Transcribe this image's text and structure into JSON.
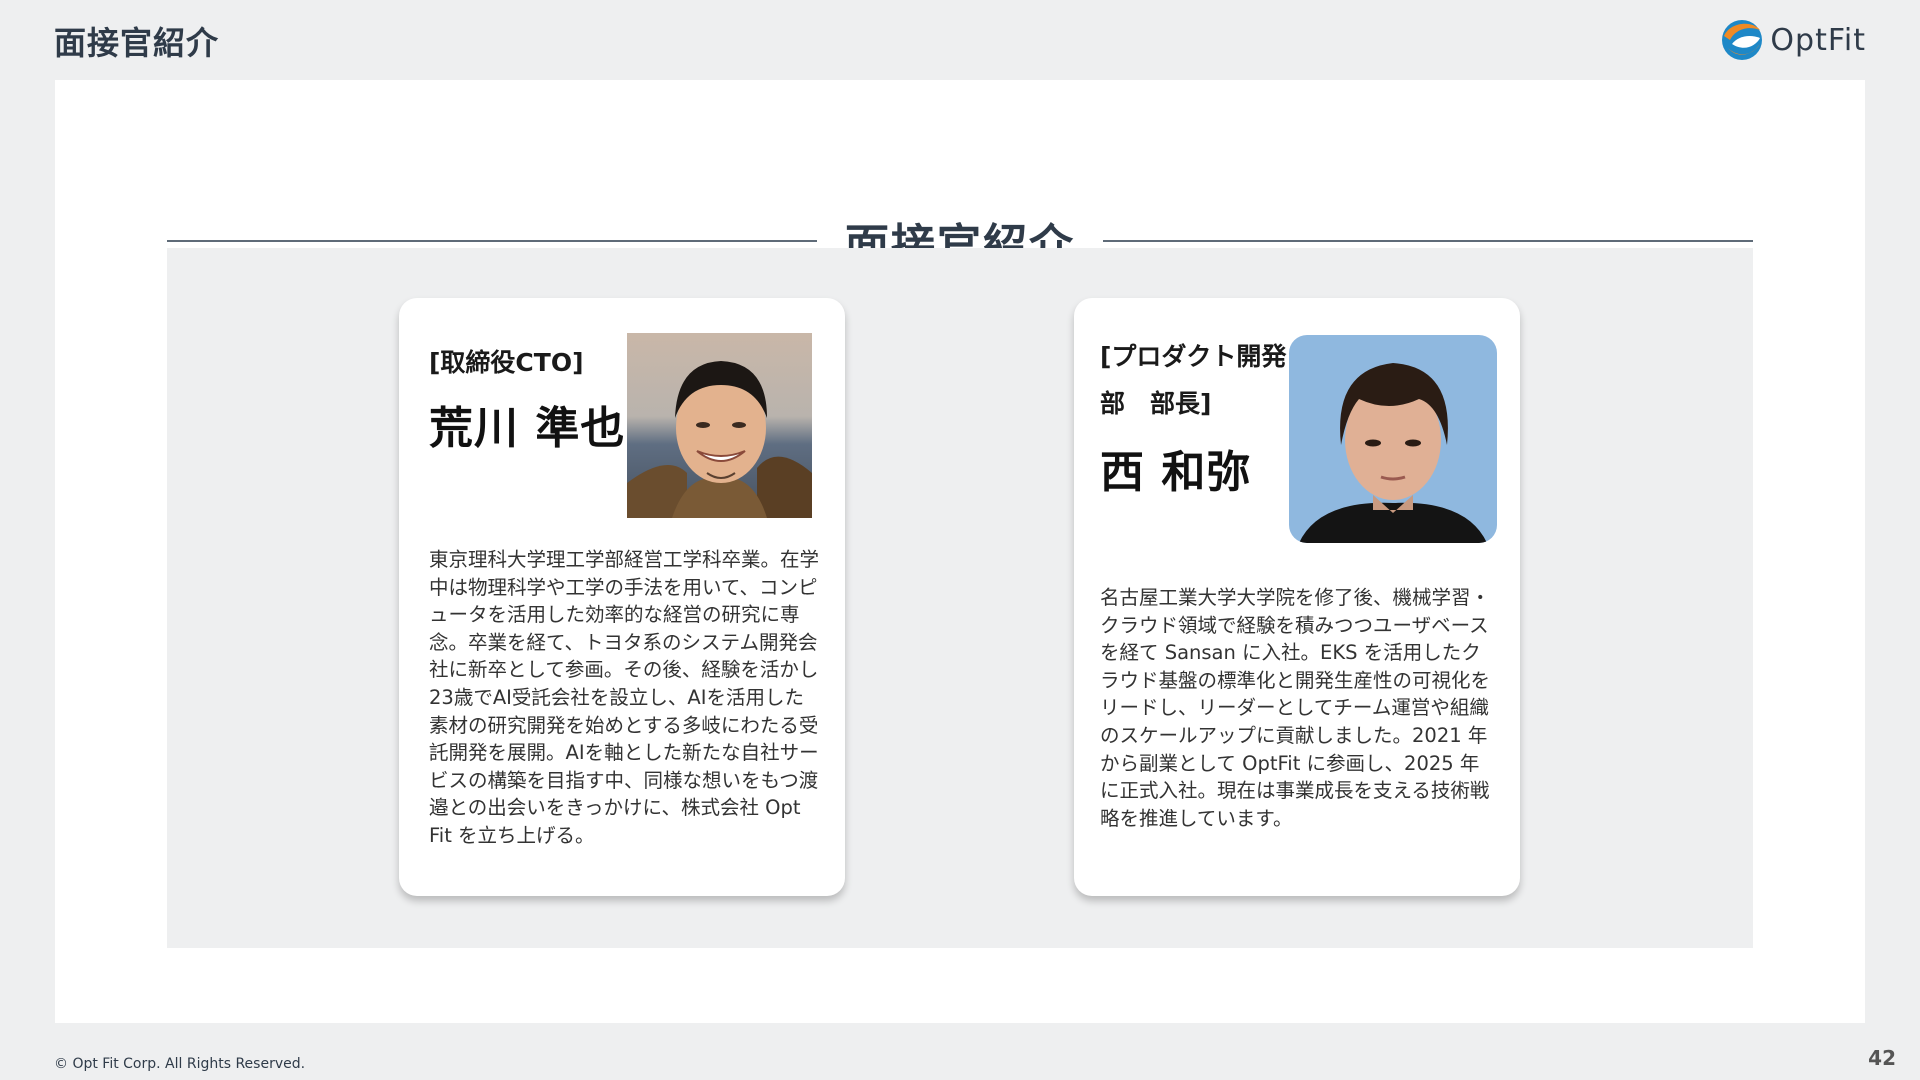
{
  "header": {
    "title": "面接官紹介"
  },
  "logo": {
    "text": "OptFit"
  },
  "section": {
    "title": "面接官紹介"
  },
  "interviewers": [
    {
      "role": "[取締役CTO]",
      "name": "荒川 準也",
      "bio": "東京理科大学理工学部経営工学科卒業。在学中は物理科学や工学の手法を用いて、コンピュータを活用した効率的な経営の研究に専念。卒業を経て、トヨタ系のシステム開発会社に新卒として参画。その後、経験を活かし23歳でAI受託会社を設立し、AIを活用した素材の研究開発を始めとする多岐にわたる受託開発を展開。AIを軸とした新たな自社サービスの構築を目指す中、同様な想いをもつ渡邉との出会いをきっかけに、株式会社 Opt Fit を立ち上げる。"
    },
    {
      "role": "[プロダクト開発部　部長]",
      "name": "西 和弥",
      "bio": "名古屋工業大学大学院を修了後、機械学習・クラウド領域で経験を積みつつユーザベースを経て Sansan に入社。EKS を活用したクラウド基盤の標準化と開発生産性の可視化をリードし、リーダーとしてチーム運営や組織のスケールアップに貢献しました。2021 年から副業として OptFit に参画し、2025 年に正式入社。現在は事業成長を支える技術戦略を推進しています。"
    }
  ],
  "footer": {
    "copyright": "© Opt Fit Corp. All Rights Reserved.",
    "page_number": "42"
  },
  "colors": {
    "accent_orange": "#f08a24",
    "accent_blue": "#1e88c7",
    "text_dark": "#2f3b49"
  }
}
